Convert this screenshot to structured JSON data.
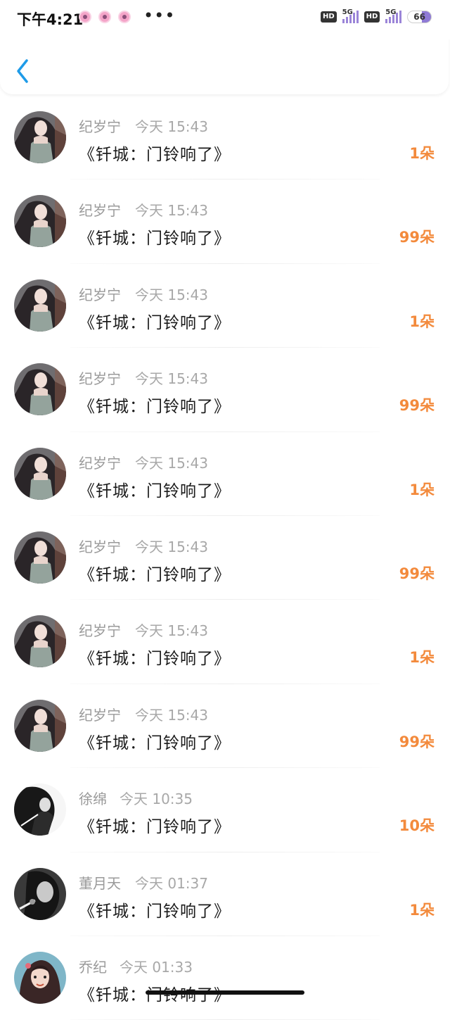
{
  "status_bar": {
    "time": "下午4:21",
    "more": "•••",
    "hd_1": "HD",
    "network_1": "5G",
    "hd_2": "HD",
    "network_2": "5G",
    "battery": "66"
  },
  "colors": {
    "accent": "#1e9be8",
    "count": "#f38a3c",
    "name": "#9a9a9a",
    "title": "#1c1c1c"
  },
  "records": [
    {
      "name": "纪岁宁",
      "time": "今天 15:43",
      "title": "《钎城：门铃响了》",
      "count": "1朵"
    },
    {
      "name": "纪岁宁",
      "time": "今天 15:43",
      "title": "《钎城：门铃响了》",
      "count": "99朵"
    },
    {
      "name": "纪岁宁",
      "time": "今天 15:43",
      "title": "《钎城：门铃响了》",
      "count": "1朵"
    },
    {
      "name": "纪岁宁",
      "time": "今天 15:43",
      "title": "《钎城：门铃响了》",
      "count": "99朵"
    },
    {
      "name": "纪岁宁",
      "time": "今天 15:43",
      "title": "《钎城：门铃响了》",
      "count": "1朵"
    },
    {
      "name": "纪岁宁",
      "time": "今天 15:43",
      "title": "《钎城：门铃响了》",
      "count": "99朵"
    },
    {
      "name": "纪岁宁",
      "time": "今天 15:43",
      "title": "《钎城：门铃响了》",
      "count": "1朵"
    },
    {
      "name": "纪岁宁",
      "time": "今天 15:43",
      "title": "《钎城：门铃响了》",
      "count": "99朵"
    },
    {
      "name": "徐绵",
      "time": "今天 10:35",
      "title": "《钎城：门铃响了》",
      "count": "10朵"
    },
    {
      "name": "董月天",
      "time": "今天 01:37",
      "title": "《钎城：门铃响了》",
      "count": "1朵"
    },
    {
      "name": "乔纪",
      "time": "今天 01:33",
      "title": "《钎城：门铃响了》",
      "count": ""
    }
  ]
}
